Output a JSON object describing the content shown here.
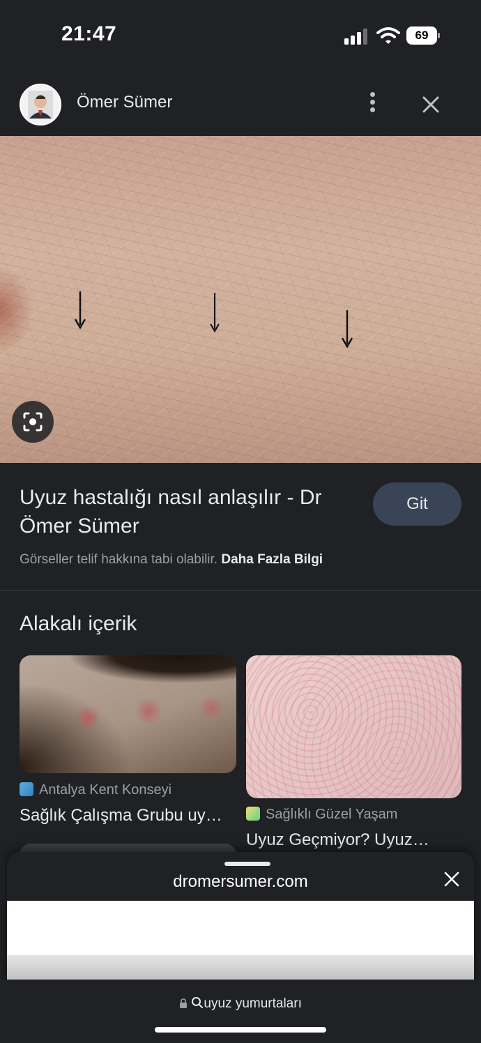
{
  "status_bar": {
    "time": "21:47",
    "battery": "69"
  },
  "header": {
    "author": "Ömer Sümer"
  },
  "result": {
    "title": "Uyuz hastalığı nasıl anlaşılır - Dr Ömer Sümer",
    "visit_label": "Git",
    "copyright_text": "Görseller telif hakkına tabi olabilir.",
    "more_info_label": "Daha Fazla Bilgi"
  },
  "related": {
    "heading": "Alakalı içerik",
    "items": [
      {
        "source": "Antalya Kent Konseyi",
        "title": "Sağlık Çalışma Grubu uy…"
      },
      {
        "source": "Sağlıklı Güzel Yaşam",
        "title": "Uyuz Geçmiyor? Uyuz…"
      }
    ]
  },
  "sheet": {
    "domain": "dromersumer.com"
  },
  "address_bar": {
    "query": "uyuz yumurtaları"
  },
  "colors": {
    "background": "#202124",
    "button": "#394457",
    "text": "#e8eaed",
    "muted": "#9aa0a6"
  },
  "icons": [
    "signal-icon",
    "wifi-icon",
    "battery-icon",
    "more-vert-icon",
    "close-icon",
    "lens-icon",
    "lock-icon",
    "search-icon"
  ]
}
